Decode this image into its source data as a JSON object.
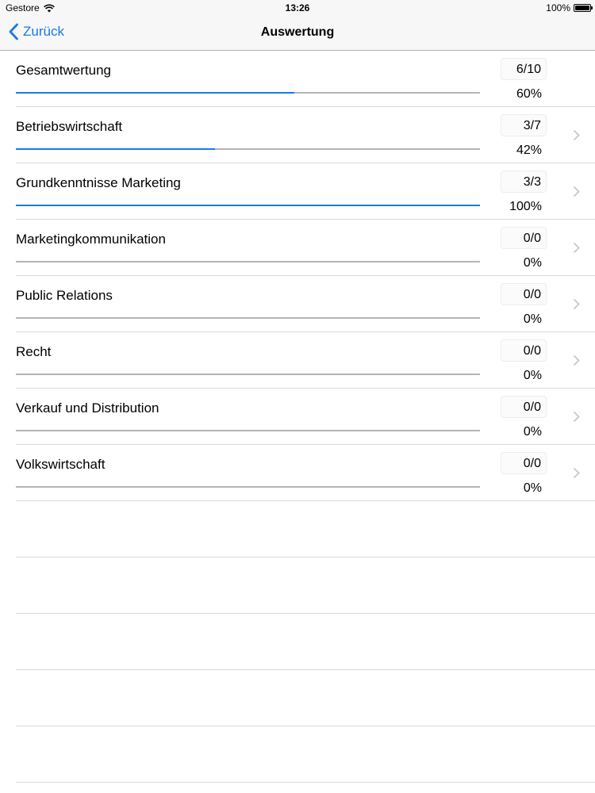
{
  "status_bar": {
    "carrier": "Gestore",
    "time": "13:26",
    "battery": "100%"
  },
  "nav": {
    "back_label": "Zurück",
    "title": "Auswertung"
  },
  "colors": {
    "accent": "#1a7ae3",
    "track": "#b4b4b4"
  },
  "rows": [
    {
      "title": "Gesamtwertung",
      "score": "6/10",
      "percent": "60%",
      "progress": 0.6,
      "chevron": false
    },
    {
      "title": "Betriebswirtschaft",
      "score": "3/7",
      "percent": "42%",
      "progress": 0.4286,
      "chevron": true
    },
    {
      "title": "Grundkenntnisse Marketing",
      "score": "3/3",
      "percent": "100%",
      "progress": 1.0,
      "chevron": true
    },
    {
      "title": "Marketingkommunikation",
      "score": "0/0",
      "percent": "0%",
      "progress": 0,
      "chevron": true
    },
    {
      "title": "Public Relations",
      "score": "0/0",
      "percent": "0%",
      "progress": 0,
      "chevron": true
    },
    {
      "title": "Recht",
      "score": "0/0",
      "percent": "0%",
      "progress": 0,
      "chevron": true
    },
    {
      "title": "Verkauf und Distribution",
      "score": "0/0",
      "percent": "0%",
      "progress": 0,
      "chevron": true
    },
    {
      "title": "Volkswirtschaft",
      "score": "0/0",
      "percent": "0%",
      "progress": 0,
      "chevron": true
    }
  ]
}
